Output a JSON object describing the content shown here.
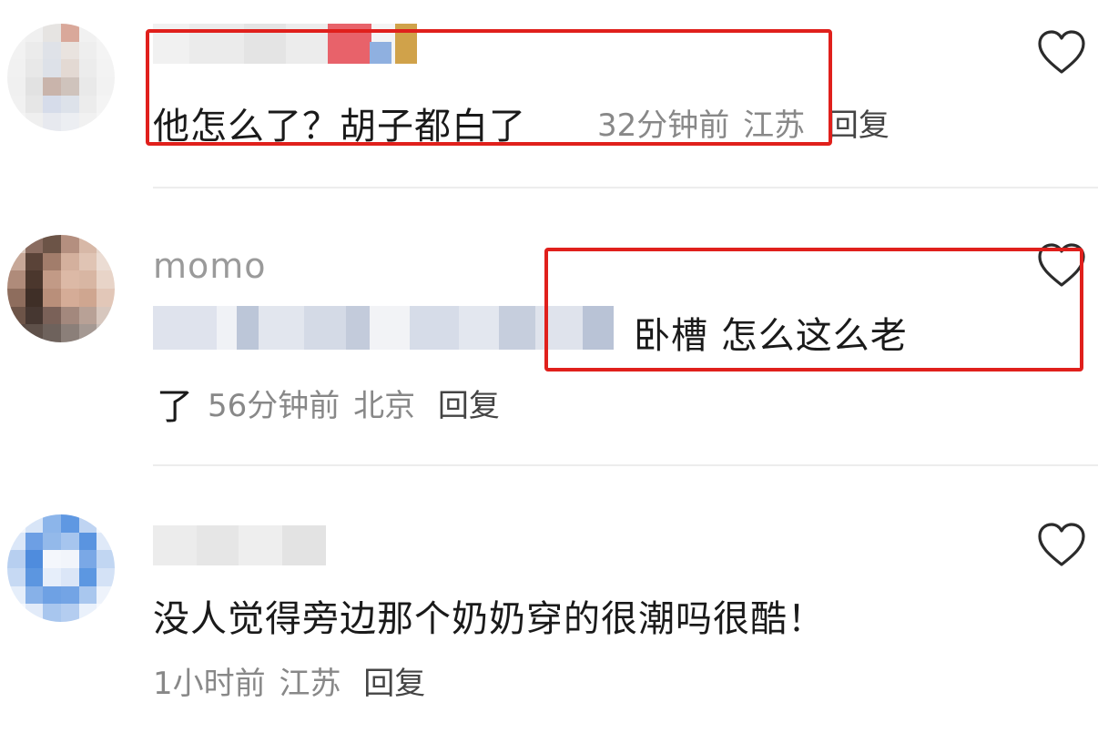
{
  "comments": [
    {
      "username": "",
      "text": "他怎么了？胡子都白了",
      "time": "32分钟前",
      "location": "江苏",
      "reply": "回复"
    },
    {
      "username": "momo",
      "text": "卧槽 怎么这么老",
      "text_cont": "了",
      "time": "56分钟前",
      "location": "北京",
      "reply": "回复"
    },
    {
      "username": "",
      "text": "没人觉得旁边那个奶奶穿的很潮吗很酷！",
      "time": "1小时前",
      "location": "江苏",
      "reply": "回复"
    }
  ],
  "icons": {
    "like": "heart-outline-icon"
  },
  "colors": {
    "highlight_box": "#e0201c",
    "meta_text": "#888888",
    "divider": "#ededed"
  }
}
